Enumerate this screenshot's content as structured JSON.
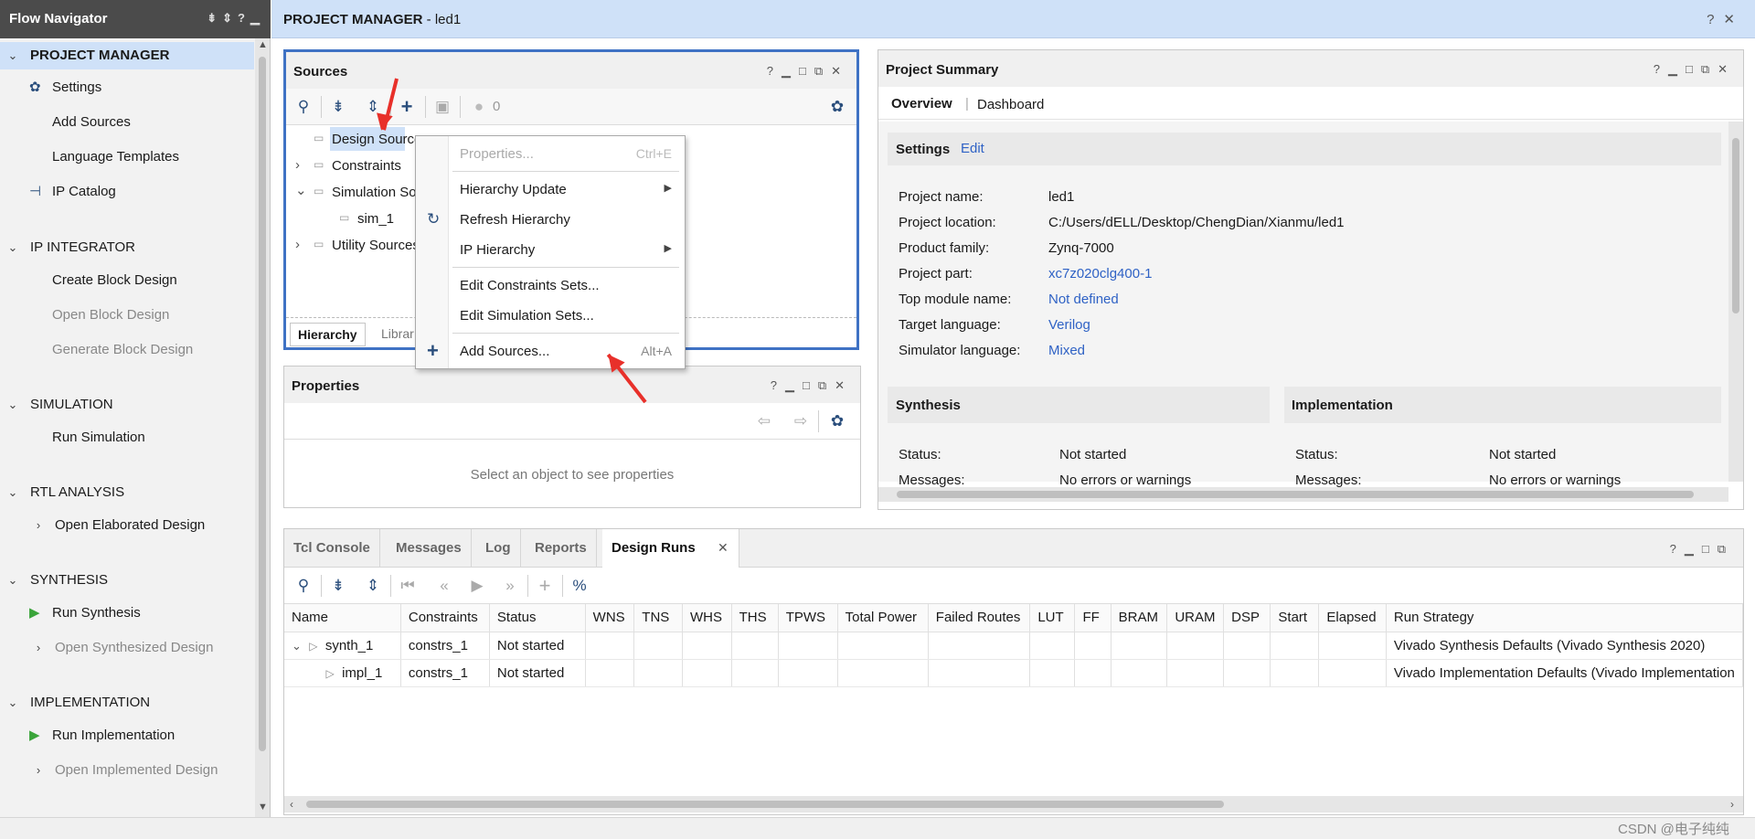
{
  "flow_navigator": {
    "title": "Flow Navigator",
    "sections": [
      {
        "label": "PROJECT MANAGER",
        "items": [
          "Settings",
          "Add Sources",
          "Language Templates",
          "IP Catalog"
        ]
      },
      {
        "label": "IP INTEGRATOR",
        "items": [
          "Create Block Design",
          "Open Block Design",
          "Generate Block Design"
        ]
      },
      {
        "label": "SIMULATION",
        "items": [
          "Run Simulation"
        ]
      },
      {
        "label": "RTL ANALYSIS",
        "items": [
          "Open Elaborated Design"
        ]
      },
      {
        "label": "SYNTHESIS",
        "items": [
          "Run Synthesis",
          "Open Synthesized Design"
        ]
      },
      {
        "label": "IMPLEMENTATION",
        "items": [
          "Run Implementation",
          "Open Implemented Design"
        ]
      }
    ]
  },
  "header": {
    "title": "PROJECT MANAGER",
    "project": " - led1"
  },
  "sources": {
    "title": "Sources",
    "count": "0",
    "tree": [
      "Design Sources",
      "Constraints",
      "Simulation Sou",
      "sim_1",
      "Utility Sources"
    ],
    "tabs": [
      "Hierarchy",
      "Librar"
    ]
  },
  "context_menu": {
    "items": [
      {
        "label": "Properties...",
        "shortcut": "Ctrl+E"
      },
      {
        "label": "Hierarchy Update"
      },
      {
        "label": "Refresh Hierarchy"
      },
      {
        "label": "IP Hierarchy"
      },
      {
        "label": "Edit Constraints Sets..."
      },
      {
        "label": "Edit Simulation Sets..."
      },
      {
        "label": "Add Sources...",
        "shortcut": "Alt+A"
      }
    ]
  },
  "properties": {
    "title": "Properties",
    "placeholder": "Select an object to see properties"
  },
  "summary": {
    "title": "Project Summary",
    "tabs": [
      "Overview",
      "Dashboard"
    ],
    "settings_label": "Settings",
    "edit_label": "Edit",
    "rows": [
      {
        "k": "Project name:",
        "v": "led1"
      },
      {
        "k": "Project location:",
        "v": "C:/Users/dELL/Desktop/ChengDian/Xianmu/led1"
      },
      {
        "k": "Product family:",
        "v": "Zynq-7000"
      },
      {
        "k": "Project part:",
        "v": "xc7z020clg400-1"
      },
      {
        "k": "Top module name:",
        "v": "Not defined"
      },
      {
        "k": "Target language:",
        "v": "Verilog"
      },
      {
        "k": "Simulator language:",
        "v": "Mixed"
      }
    ],
    "synthesis": {
      "title": "Synthesis",
      "status_k": "Status:",
      "status_v": "Not started",
      "msg_k": "Messages:",
      "msg_v": "No errors or warnings"
    },
    "implementation": {
      "title": "Implementation",
      "status_k": "Status:",
      "status_v": "Not started",
      "msg_k": "Messages:",
      "msg_v": "No errors or warnings"
    }
  },
  "bottom": {
    "tabs": [
      "Tcl Console",
      "Messages",
      "Log",
      "Reports",
      "Design Runs"
    ],
    "columns": [
      "Name",
      "Constraints",
      "Status",
      "WNS",
      "TNS",
      "WHS",
      "THS",
      "TPWS",
      "Total Power",
      "Failed Routes",
      "LUT",
      "FF",
      "BRAM",
      "URAM",
      "DSP",
      "Start",
      "Elapsed",
      "Run Strategy"
    ],
    "rows": [
      {
        "name": "synth_1",
        "constraints": "constrs_1",
        "status": "Not started",
        "strategy": "Vivado Synthesis Defaults (Vivado Synthesis 2020)"
      },
      {
        "name": "impl_1",
        "constraints": "constrs_1",
        "status": "Not started",
        "strategy": "Vivado Implementation Defaults (Vivado Implementation"
      }
    ]
  },
  "watermark": "CSDN @电子纯纯",
  "colors": {
    "accent": "#2f62c5",
    "header_bg": "#cfe1f8",
    "nav_head": "#4b4b4b",
    "arrow": "#e8302a",
    "run_green": "#3aa43a"
  }
}
